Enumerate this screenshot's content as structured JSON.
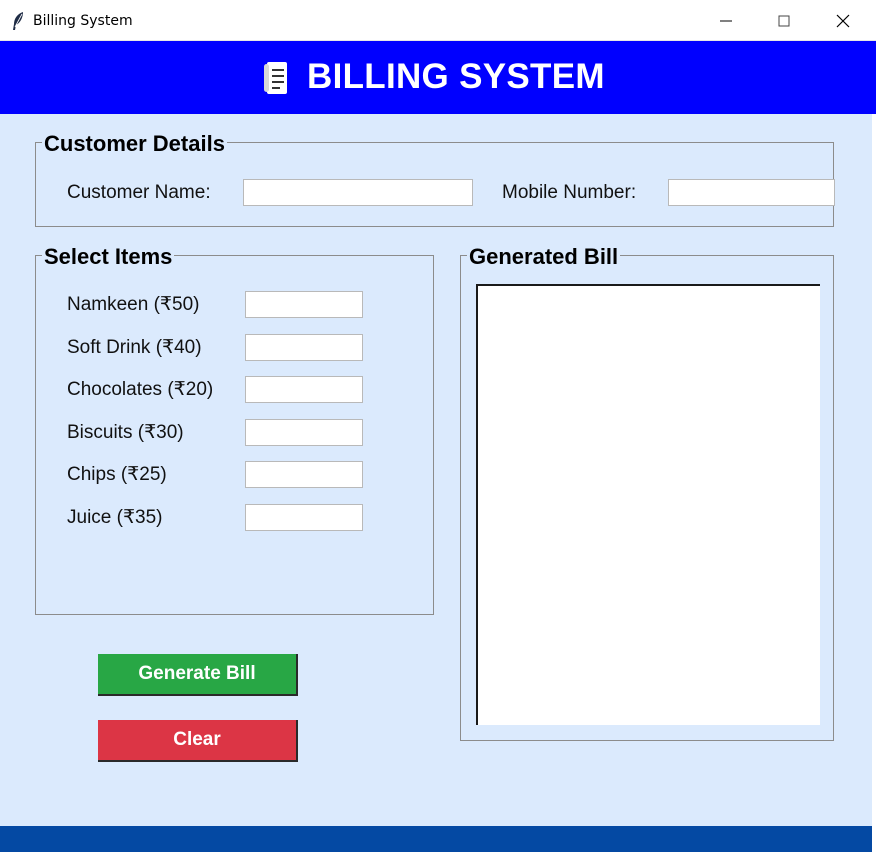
{
  "window": {
    "title": "Billing System",
    "icon": "feather-icon",
    "controls": [
      "minimize-icon",
      "maximize-icon",
      "close-icon"
    ]
  },
  "header": {
    "title": "BILLING SYSTEM",
    "icon": "receipt-icon",
    "background": "#0000ff"
  },
  "customer": {
    "legend": "Customer Details",
    "name_label": "Customer Name:",
    "name_value": "",
    "mobile_label": "Mobile Number:",
    "mobile_value": ""
  },
  "items": {
    "legend": "Select Items",
    "list": [
      {
        "label": "Namkeen (₹50)",
        "value": ""
      },
      {
        "label": "Soft Drink (₹40)",
        "value": ""
      },
      {
        "label": "Chocolates (₹20)",
        "value": ""
      },
      {
        "label": "Biscuits (₹30)",
        "value": ""
      },
      {
        "label": "Chips (₹25)",
        "value": ""
      },
      {
        "label": "Juice (₹35)",
        "value": ""
      }
    ]
  },
  "bill": {
    "legend": "Generated Bill",
    "content": ""
  },
  "buttons": {
    "generate_label": "Generate Bill",
    "generate_color": "#28a745",
    "clear_label": "Clear",
    "clear_color": "#dc3545"
  },
  "colors": {
    "background": "#dbeafd",
    "footer": "#0449a3"
  }
}
